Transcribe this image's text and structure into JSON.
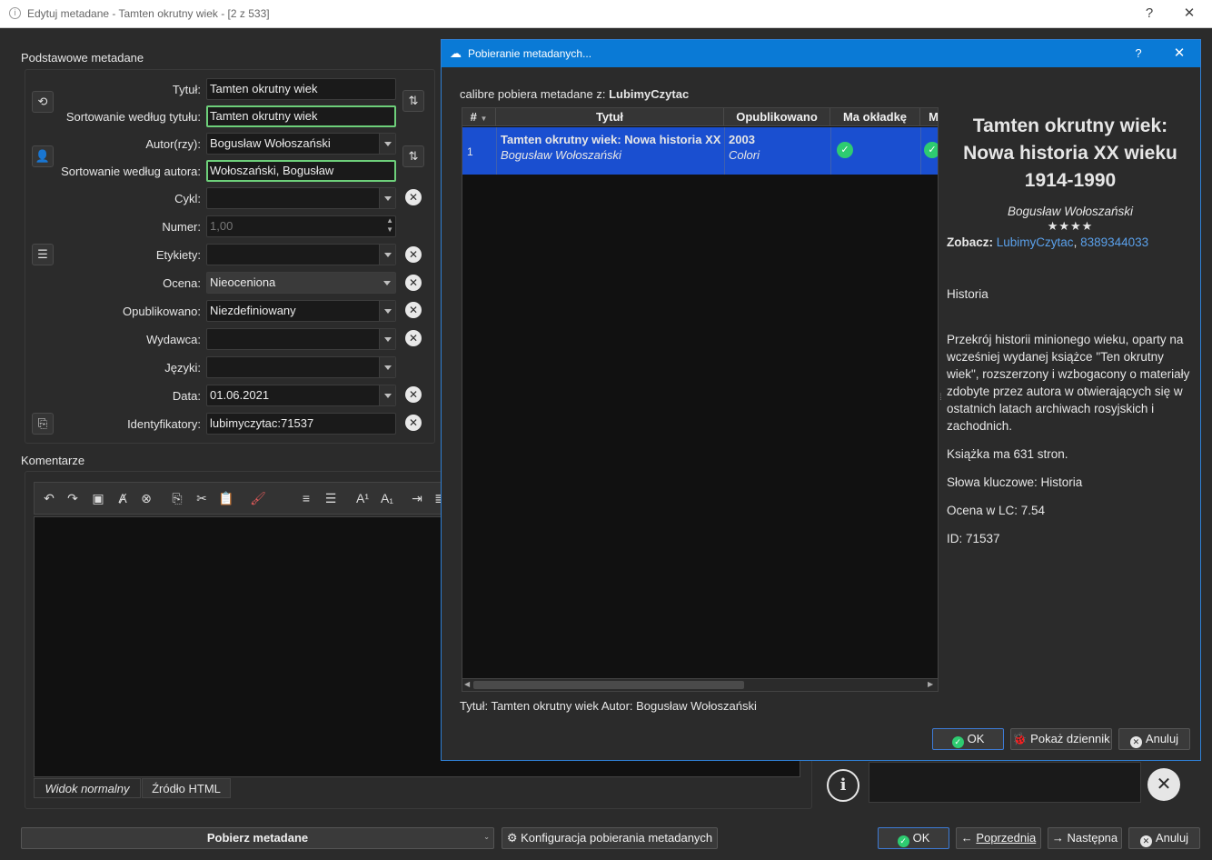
{
  "window": {
    "title": "Edytuj metadane - Tamten okrutny wiek -  [2 z 533]",
    "help_label": "?",
    "close_label": "✕"
  },
  "basic": {
    "group_title": "Podstawowe metadane",
    "title_label": "Tytuł:",
    "title_value": "Tamten okrutny wiek",
    "title_sort_label": "Sortowanie według tytułu:",
    "title_sort_value": "Tamten okrutny wiek",
    "author_label": "Autor(rzy):",
    "author_value": "Bogusław Wołoszański",
    "author_sort_label": "Sortowanie według autora:",
    "author_sort_value": "Wołoszański, Bogusław",
    "series_label": "Cykl:",
    "series_value": "",
    "number_label": "Numer:",
    "number_value": "1,00",
    "tags_label": "Etykiety:",
    "tags_value": "",
    "rating_label": "Ocena:",
    "rating_value": "Nieoceniona",
    "published_label": "Opublikowano:",
    "published_value": "Niezdefiniowany",
    "publisher_label": "Wydawca:",
    "publisher_value": "",
    "languages_label": "Języki:",
    "languages_value": "",
    "date_label": "Data:",
    "date_value": "01.06.2021",
    "identifiers_label": "Identyfikatory:",
    "identifiers_value": "lubimyczytac:71537"
  },
  "comments": {
    "group_title": "Komentarze",
    "tab_normal": "Widok normalny",
    "tab_html": "Źródło HTML"
  },
  "bottom": {
    "download_metadata": "Pobierz metadane",
    "configure_download": "Konfiguracja pobierania metadanych",
    "ok": "OK",
    "previous": "Poprzednia",
    "next": "Następna",
    "cancel": "Anuluj"
  },
  "dialog": {
    "title": "Pobieranie metadanych...",
    "help_label": "?",
    "close_label": "✕",
    "source_prefix": "calibre pobiera metadane z:",
    "source_name": "LubimyCzytac",
    "columns": [
      "#",
      "Tytuł",
      "Opublikowano",
      "Ma okładkę",
      "M"
    ],
    "row": {
      "num": "1",
      "title": "Tamten okrutny wiek: Nowa historia XX",
      "author": "Bogusław Wołoszański",
      "year": "2003",
      "publisher": "Colori"
    },
    "query_status": "Tytuł: Tamten okrutny wiek Autor: Bogusław Wołoszański",
    "ok": "OK",
    "show_log": "Pokaż dziennik",
    "cancel": "Anuluj",
    "detail": {
      "title_line1": "Tamten okrutny wiek:",
      "title_line2": "Nowa historia XX wieku",
      "title_line3": "1914-1990",
      "author": "Bogusław Wołoszański",
      "stars": "★★★★",
      "see_label": "Zobacz:",
      "link1": "LubimyCzytac",
      "link_sep": ",",
      "link2": "8389344033",
      "genre": "Historia",
      "description": "Przekrój historii minionego wieku, oparty na wcześniej wydanej książce \"Ten okrutny wiek\", rozszerzony i wzbogacony o materiały zdobyte przez autora w otwierających się w ostatnich latach archiwach rosyjskich i zachodnich.",
      "pages": "Książka ma 631 stron.",
      "keywords": "Słowa kluczowe: Historia",
      "lc_rating": "Ocena w LC: 7.54",
      "id": "ID: 71537"
    }
  },
  "colors": {
    "accent": "#0a7ad6",
    "selection": "#1a4fd0",
    "focus_border": "#6dcf7a",
    "ok_green": "#2ecc71",
    "link": "#5aa0ea"
  }
}
